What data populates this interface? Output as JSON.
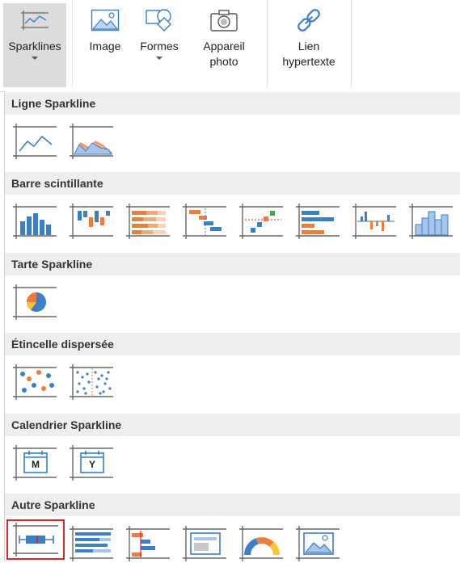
{
  "ribbon": {
    "sparklines": "Sparklines",
    "image": "Image",
    "formes": "Formes",
    "appareil_line1": "Appareil",
    "appareil_line2": "photo",
    "lien_line1": "Lien",
    "lien_line2": "hypertexte"
  },
  "sections": {
    "ligne": "Ligne Sparkline",
    "barre": "Barre scintillante",
    "tarte": "Tarte Sparkline",
    "etincelle": "Étincelle dispersée",
    "calendrier": "Calendrier Sparkline",
    "autre": "Autre Sparkline"
  },
  "calendar": {
    "month": "M",
    "year": "Y"
  },
  "colors": {
    "accent_blue": "#3a7fc8",
    "accent_orange": "#f07b3f",
    "selection_red": "#d9262e"
  }
}
